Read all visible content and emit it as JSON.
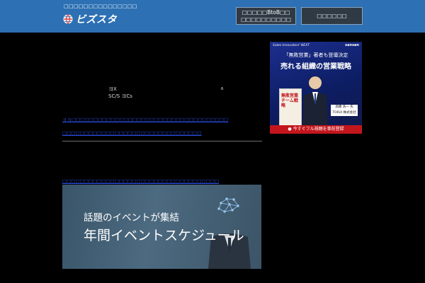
{
  "header": {
    "tagline": "□□□□□□□□□□□□□□□",
    "logo_text": "ビズスタ",
    "button_primary_line1": "□□□□□BtoB□□",
    "button_primary_line2": "□□□□□□□□□□",
    "button_secondary": "□□□□□□"
  },
  "article": {
    "text_left_1": "ヨX",
    "text_right_1": "∧",
    "text_left_2": "SC/S ヨCs",
    "link_1": "ョョ□□□□□□□□□□□□□□□□□□□□□□□□□□□□□□□□□□□□",
    "link_2": "□□□□□□□□□□□□□□□□□□□□□□□□□□□□□□□□",
    "link_3": "□□□□□□□□□□□□□□□□□□□□□□□□□□□□□□□□□□□□"
  },
  "ad": {
    "top_left": "Sales Innovators' NEXT",
    "top_right": "sansan",
    "line1": "「無敗営業」著者も登壇決定",
    "line2": "売れる組織の営業戦略",
    "book_title": "無敗営業チーム戦略",
    "speaker": "高橋 浩一 氏",
    "speaker_company": "TORiX 株式会社",
    "cta": "今すぐフル視聴を事前登録"
  },
  "event_banner": {
    "line1": "話題のイベントが集結",
    "line2": "年間イベントスケジュール"
  },
  "colors": {
    "header_bg": "#2d70b3",
    "link": "#2b4de0",
    "ad_cta": "#c3161c"
  }
}
